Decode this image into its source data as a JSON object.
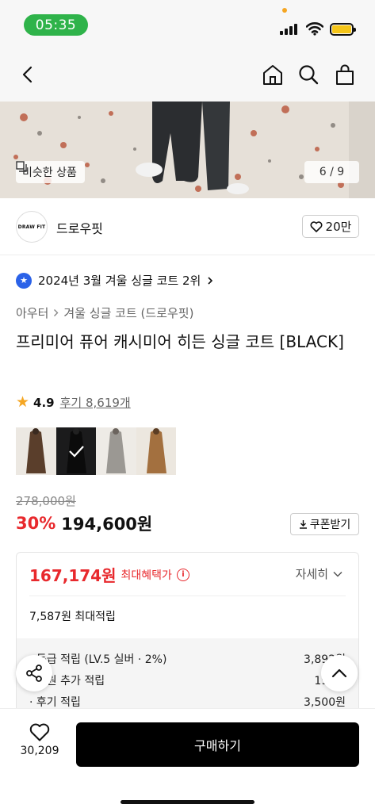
{
  "status": {
    "time": "05:35"
  },
  "nav": {
    "back_icon": "chevron-left-icon",
    "home_icon": "home-icon",
    "search_icon": "search-icon",
    "cart_icon": "shopping-bag-icon"
  },
  "hero": {
    "similar_label": "비슷한 상품",
    "page_indicator": "6 / 9"
  },
  "brand": {
    "logo_text": "DRAW FIT",
    "name": "드로우핏",
    "like_count": "20만"
  },
  "ranking": {
    "label": "2024년 3월 겨울 싱글 코트 2위"
  },
  "breadcrumb": {
    "category": "아우터",
    "subcategory": "겨울 싱글 코트 (드로우핏)"
  },
  "product": {
    "title": "프리미어 퓨어 캐시미어 히든 싱글 코트 [BLACK]",
    "rating": "4.9",
    "reviews": "후기 8,619개",
    "thumbnail_colors": [
      "#5a3e2b",
      "#1d1d1f",
      "#9b9893",
      "#a3703f"
    ],
    "selected_thumbnail": 1
  },
  "price": {
    "original": "278,000원",
    "discount": "30%",
    "sale": "194,600원",
    "coupon_label": "쿠폰받기"
  },
  "benefit": {
    "max_price": "167,174원",
    "max_label": "최대혜택가",
    "detail_label": "자세히",
    "points_total": "7,587원 최대적립",
    "rows": [
      {
        "label": "· 등급 적립 (LV.5 실버 · 2%)",
        "value": "3,892원"
      },
      {
        "label": "· 회원 추가 적립",
        "value": "195원"
      },
      {
        "label": "· 후기 적립",
        "value": "3,500원"
      }
    ]
  },
  "bottom": {
    "wish_count": "30,209",
    "buy_label": "구매하기"
  },
  "colors": {
    "accent_red": "#e8292d",
    "badge_blue": "#2b62e8",
    "status_green": "#2fb34a",
    "star": "#f5a623"
  }
}
